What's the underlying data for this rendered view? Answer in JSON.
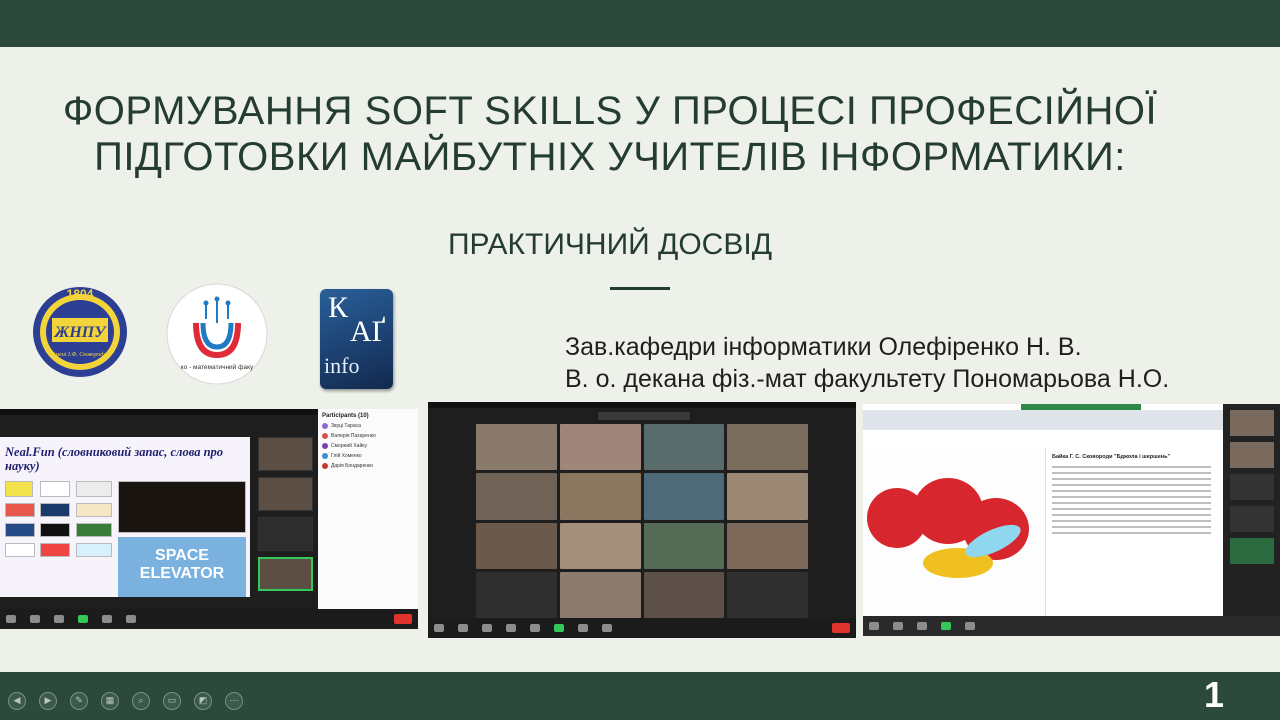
{
  "slide": {
    "title_line1": "ФОРМУВАННЯ SOFT SKILLS У ПРОЦЕСІ ПРОФЕСІЙНОЇ",
    "title_line2": "ПІДГОТОВКИ МАЙБУТНІХ УЧИТЕЛІВ ІНФОРМАТИКИ:",
    "subtitle": "ПРАКТИЧНИЙ ДОСВІД",
    "author1": "Зав.кафедри інформатики Олефіренко Н. В.",
    "author2": "В. о. декана фіз.-мат факультету Пономарьова Н.О.",
    "page_number": "1"
  },
  "logos": {
    "jnpu_year": "1804",
    "jnpu_name": "ЖНПУ",
    "jnpu_sub": "імені І.Ф. Сковороди",
    "fmf_ring": "ко - математичний факу",
    "kaf_k": "К",
    "kaf_a": "АҐ",
    "kaf_info": "info"
  },
  "screenshots": {
    "shot1": {
      "neal_title": "Neal.Fun (словниковий запас, слова про науку)",
      "space_label": "SPACE ELEVATOR",
      "participants_title": "Participants (10)",
      "participants": [
        "Звуці Тараса",
        "Валерія Пахаренко",
        "Сморний Хайку",
        "Глій Хоменко",
        "Дарія Бондаренко"
      ],
      "participant_colors": [
        "#8d6ad3",
        "#d9534f",
        "#7a3fb0",
        "#3a8ed6",
        "#c0392b"
      ]
    },
    "shot3": {
      "doc_title": "Байка Г. С. Сковороди \"Бджола і шершень\""
    }
  },
  "colors": {
    "bar": "#2b4a3b",
    "background": "#eef1ea",
    "title_text": "#243d30"
  }
}
